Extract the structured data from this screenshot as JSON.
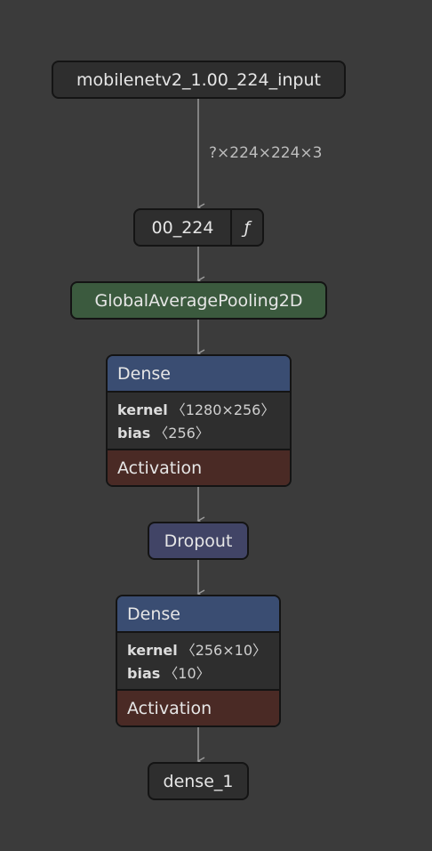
{
  "graph": {
    "input": {
      "label": "mobilenetv2_1.00_224_input"
    },
    "edge_shape": "?×224×224×3",
    "func": {
      "label": "00_224",
      "glyph": "ƒ"
    },
    "pool": {
      "label": "GlobalAveragePooling2D"
    },
    "dense1": {
      "title": "Dense",
      "kernel_label": "kernel",
      "kernel_value": "〈1280×256〉",
      "bias_label": "bias",
      "bias_value": "〈256〉",
      "activation": "Activation"
    },
    "dropout": {
      "label": "Dropout"
    },
    "dense2": {
      "title": "Dense",
      "kernel_label": "kernel",
      "kernel_value": "〈256×10〉",
      "bias_label": "bias",
      "bias_value": "〈10〉",
      "activation": "Activation"
    },
    "output": {
      "label": "dense_1"
    }
  },
  "colors": {
    "background": "#3b3b3b",
    "node": "#2e2e2e",
    "pool": "#3b5a3e",
    "dense_header": "#3a4d72",
    "activation": "#4a2a25",
    "dropout": "#414466",
    "edge": "#9a9a9a"
  }
}
